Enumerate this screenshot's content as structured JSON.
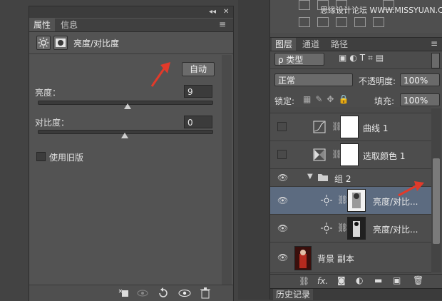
{
  "properties_panel": {
    "strip_buttons": [
      "◂◂",
      "✕"
    ],
    "tabs": [
      {
        "label": "属性"
      },
      {
        "label": "信息"
      }
    ],
    "menu_icon": "≡",
    "title": "亮度/对比度",
    "auto_label": "自动",
    "brightness": {
      "label": "亮度：",
      "value": "9",
      "level": 0.516
    },
    "contrast": {
      "label": "对比度：",
      "value": "0",
      "level": 0.5
    },
    "legacy_label": "使用旧版",
    "footer_icons": [
      "clip-to-layer-icon",
      "view-previous-icon",
      "reset-icon",
      "visibility-icon",
      "delete-icon"
    ]
  },
  "watermark": "思缘设计论坛 WWW.MISSYUAN.COM",
  "layers_panel": {
    "tabs": [
      {
        "label": "图层"
      },
      {
        "label": "通道"
      },
      {
        "label": "路径"
      }
    ],
    "filter_label": "ρ 类型",
    "blend_mode": "正常",
    "opacity_label": "不透明度:",
    "opacity_value": "100%",
    "lock_label": "锁定:",
    "fill_label": "填充:",
    "fill_value": "100%",
    "layers": [
      {
        "name": "曲线 1",
        "visible": false,
        "selected": false,
        "type": "curves"
      },
      {
        "name": "选取颜色 1",
        "visible": false,
        "selected": false,
        "type": "selective-color"
      },
      {
        "name": "组 2",
        "visible": true,
        "selected": false,
        "type": "group"
      },
      {
        "name": "亮度/对比...",
        "visible": true,
        "selected": true,
        "type": "brightness"
      },
      {
        "name": "亮度/对比...",
        "visible": true,
        "selected": false,
        "type": "brightness"
      },
      {
        "name": "背景 副本",
        "visible": true,
        "selected": false,
        "type": "image"
      }
    ],
    "footer_icons": [
      "link-icon",
      "fx-icon",
      "mask-icon",
      "adjustment-icon",
      "folder-icon",
      "new-layer-icon",
      "trash-icon"
    ]
  },
  "history_tab": "历史记录"
}
